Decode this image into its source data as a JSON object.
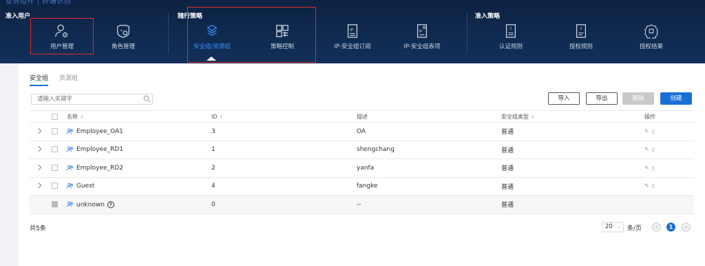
{
  "header": {
    "clipped_text": "业务组件 | 终端识别",
    "groups": [
      {
        "title": "准入用户"
      },
      {
        "title": "随行策略"
      },
      {
        "title": "准入策略"
      }
    ],
    "nav_items": [
      {
        "label": "用户管理",
        "icon": "user-settings-icon"
      },
      {
        "label": "角色管理",
        "icon": "role-badge-icon"
      },
      {
        "label": "安全组/资源组",
        "icon": "layers-icon"
      },
      {
        "label": "策略控制",
        "icon": "grid-control-icon"
      },
      {
        "label": "IP-安全组订阅",
        "icon": "ip-document-icon"
      },
      {
        "label": "IP-安全组表项",
        "icon": "ip-table-icon"
      },
      {
        "label": "认证规则",
        "icon": "auth-rule-icon"
      },
      {
        "label": "授权规则",
        "icon": "authz-rule-icon"
      },
      {
        "label": "授权结果",
        "icon": "authz-result-icon"
      }
    ],
    "active_item": "安全组/资源组",
    "highlight_color": "#e0292c"
  },
  "tabs": [
    {
      "label": "安全组",
      "active": true
    },
    {
      "label": "资源组",
      "active": false
    }
  ],
  "search": {
    "placeholder": "请输入关键字"
  },
  "toolbar": {
    "import_label": "导入",
    "export_label": "导出",
    "delete_label": "删除",
    "create_label": "创建"
  },
  "table": {
    "columns": [
      "名称",
      "ID",
      "描述",
      "安全组类型",
      "操作"
    ],
    "sort_glyph": "⇕",
    "rows": [
      {
        "name": "Employee_OA1",
        "id": "3",
        "desc": "OA",
        "type": "普通"
      },
      {
        "name": "Employee_RD1",
        "id": "1",
        "desc": "shengchang",
        "type": "普通"
      },
      {
        "name": "Employee_RD2",
        "id": "2",
        "desc": "yanfa",
        "type": "普通"
      },
      {
        "name": "Guest",
        "id": "4",
        "desc": "fangke",
        "type": "普通"
      },
      {
        "name": "unknown",
        "id": "0",
        "desc": "--",
        "type": "普通"
      }
    ],
    "help_glyph": "?"
  },
  "pagination": {
    "total_text": "共5条",
    "page_size": "20",
    "per_page_unit": "条/页",
    "current_page": "1",
    "prev_glyph": "‹",
    "next_glyph": "›"
  },
  "colors": {
    "accent": "#1a6fd6",
    "header_bg": "#0f2748"
  }
}
